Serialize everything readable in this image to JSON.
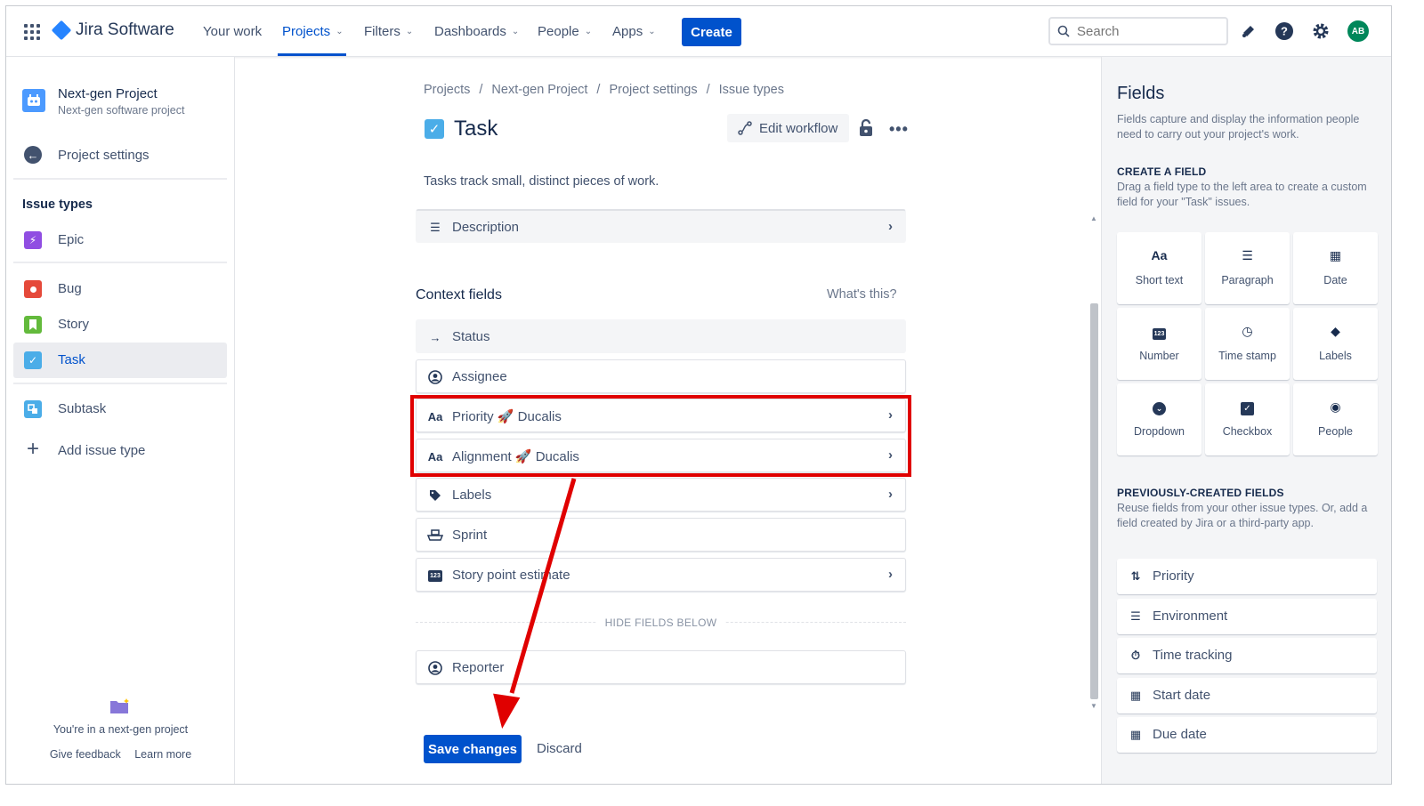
{
  "topnav": {
    "brand": "Jira Software",
    "items": [
      {
        "label": "Your work",
        "chevron": false
      },
      {
        "label": "Projects",
        "chevron": true,
        "active": true
      },
      {
        "label": "Filters",
        "chevron": true
      },
      {
        "label": "Dashboards",
        "chevron": true
      },
      {
        "label": "People",
        "chevron": true
      },
      {
        "label": "Apps",
        "chevron": true
      }
    ],
    "create_label": "Create",
    "search_placeholder": "Search",
    "avatar_initials": "AB"
  },
  "sidebar": {
    "project_name": "Next-gen Project",
    "project_type": "Next-gen software project",
    "back_label": "Project settings",
    "section_heading": "Issue types",
    "items": [
      {
        "label": "Epic",
        "color": "#904ee2",
        "glyph": "⚡"
      },
      {
        "label": "Bug",
        "color": "#e5493a",
        "glyph": "●"
      },
      {
        "label": "Story",
        "color": "#63ba3c",
        "glyph": "▮"
      },
      {
        "label": "Task",
        "color": "#4bade8",
        "glyph": "✓",
        "selected": true
      },
      {
        "label": "Subtask",
        "color": "#4bade8",
        "glyph": "❐"
      }
    ],
    "add_label": "Add issue type",
    "footer_text": "You're in a next-gen project",
    "footer_links": [
      "Give feedback",
      "Learn more"
    ]
  },
  "main": {
    "breadcrumb": [
      "Projects",
      "Next-gen Project",
      "Project settings",
      "Issue types"
    ],
    "title": "Task",
    "edit_workflow_label": "Edit workflow",
    "description": "Tasks track small, distinct pieces of work.",
    "description_field": "Description",
    "context_heading": "Context fields",
    "whats_this": "What's this?",
    "context_fields": [
      {
        "label": "Status",
        "icon": "arrow-right-icon",
        "glyph": "→",
        "chevron": false,
        "grey": true
      },
      {
        "label": "Assignee",
        "icon": "person-icon",
        "glyph": "◉",
        "chevron": false
      },
      {
        "label": "Priority 🚀 Ducalis",
        "icon": "text-field-icon",
        "glyph": "Aa",
        "chevron": true
      },
      {
        "label": "Alignment 🚀 Ducalis",
        "icon": "text-field-icon",
        "glyph": "Aa",
        "chevron": true
      },
      {
        "label": "Labels",
        "icon": "tag-icon",
        "glyph": "◆",
        "chevron": true
      },
      {
        "label": "Sprint",
        "icon": "sprint-icon",
        "glyph": "⛴",
        "chevron": false
      },
      {
        "label": "Story point estimate",
        "icon": "number-icon",
        "glyph": "123",
        "chevron": true
      }
    ],
    "hide_label": "HIDE FIELDS BELOW",
    "hidden_fields": [
      {
        "label": "Reporter",
        "icon": "person-icon",
        "glyph": "◉"
      }
    ],
    "save_label": "Save changes",
    "discard_label": "Discard",
    "highlight_color": "#e00000"
  },
  "rpanel": {
    "title": "Fields",
    "description": "Fields capture and display the information people need to carry out your project's work.",
    "create_heading": "CREATE A FIELD",
    "create_desc": "Drag a field type to the left area to create a custom field for your \"Task\" issues.",
    "field_types": [
      {
        "label": "Short text",
        "glyph": "Aa",
        "icon": "short-text-icon"
      },
      {
        "label": "Paragraph",
        "glyph": "☰",
        "icon": "paragraph-icon"
      },
      {
        "label": "Date",
        "glyph": "▦",
        "icon": "date-icon"
      },
      {
        "label": "Number",
        "glyph": "123",
        "icon": "number-icon"
      },
      {
        "label": "Time stamp",
        "glyph": "◷",
        "icon": "clock-icon"
      },
      {
        "label": "Labels",
        "glyph": "◆",
        "icon": "tag-icon"
      },
      {
        "label": "Dropdown",
        "glyph": "⌄",
        "icon": "dropdown-icon"
      },
      {
        "label": "Checkbox",
        "glyph": "☑",
        "icon": "checkbox-icon"
      },
      {
        "label": "People",
        "glyph": "◉",
        "icon": "person-icon"
      }
    ],
    "prev_heading": "PREVIOUSLY-CREATED FIELDS",
    "prev_desc": "Reuse fields from your other issue types. Or, add a field created by Jira or a third-party app.",
    "prev_fields": [
      {
        "label": "Priority",
        "glyph": "⇅",
        "icon": "priority-icon"
      },
      {
        "label": "Environment",
        "glyph": "☰",
        "icon": "paragraph-icon"
      },
      {
        "label": "Time tracking",
        "glyph": "⏱",
        "icon": "stopwatch-icon"
      },
      {
        "label": "Start date",
        "glyph": "▦",
        "icon": "calendar-icon"
      },
      {
        "label": "Due date",
        "glyph": "▦",
        "icon": "calendar-icon"
      }
    ]
  }
}
